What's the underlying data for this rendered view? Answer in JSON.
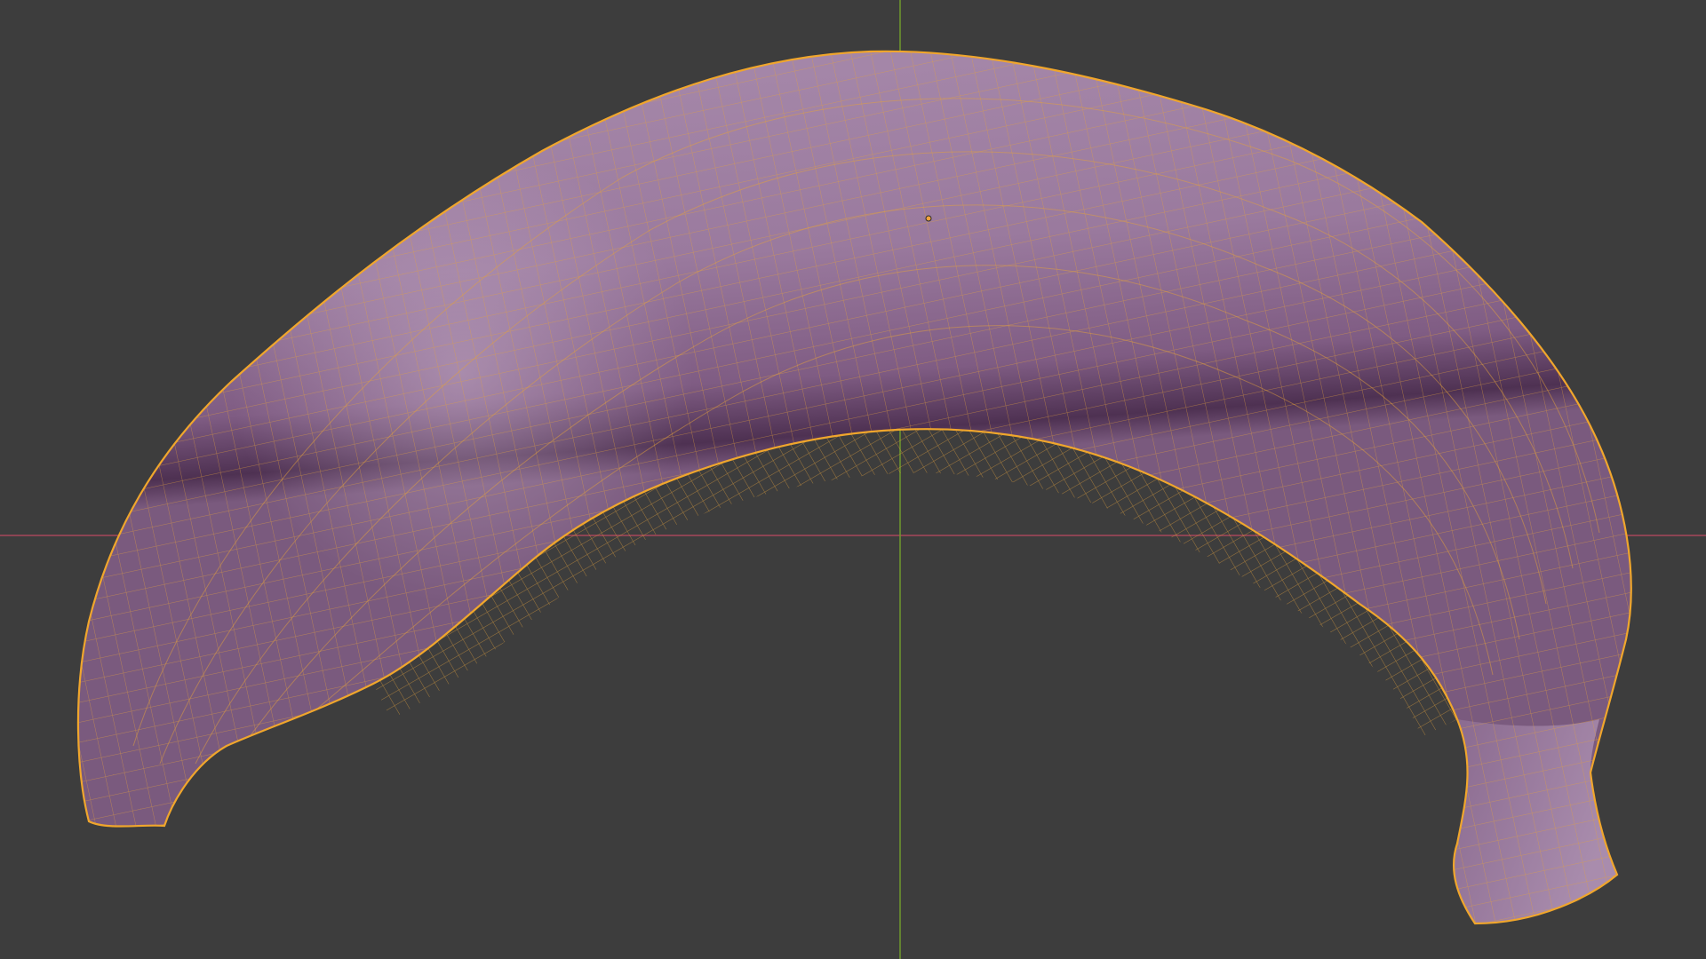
{
  "viewport": {
    "background_color": "#3d3d3d",
    "grid_floor_visible": false
  },
  "axes": {
    "x_axis_color": "#a6475b",
    "y_axis_color": "#6f9a2c"
  },
  "object": {
    "name_shown": false,
    "mode": "edit",
    "selected": true,
    "shape": "banana",
    "surface_color": "#9c7ca0",
    "wireframe_color": "#e3a23c",
    "outline_color": "#f0a62c",
    "origin_marker_color": "#f2a23a"
  }
}
